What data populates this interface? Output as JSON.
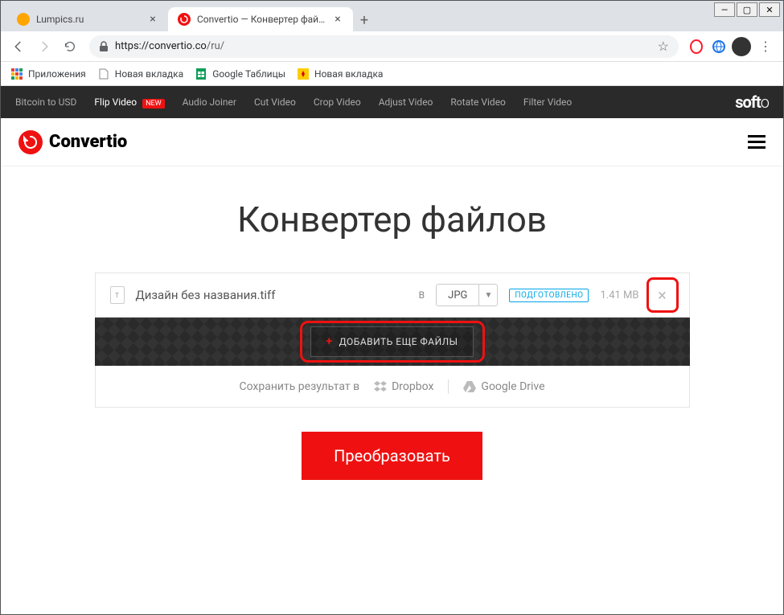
{
  "window": {
    "tabs": [
      {
        "title": "Lumpics.ru",
        "active": false
      },
      {
        "title": "Convertio — Конвертер файлов",
        "active": true
      }
    ]
  },
  "toolbar": {
    "url_scheme": "https://",
    "url_host": "convertio.co",
    "url_path": "/ru/"
  },
  "bookmarks": [
    {
      "label": "Приложения"
    },
    {
      "label": "Новая вкладка"
    },
    {
      "label": "Google Таблицы"
    },
    {
      "label": "Новая вкладка"
    }
  ],
  "promo": {
    "items": [
      "Bitcoin to USD",
      "Flip Video",
      "Audio Joiner",
      "Cut Video",
      "Crop Video",
      "Adjust Video",
      "Rotate Video",
      "Filter Video"
    ],
    "new_badge": "NEW",
    "brand": "softo"
  },
  "header": {
    "logo": "Convertio"
  },
  "main": {
    "title": "Конвертер файлов",
    "file": {
      "name": "Дизайн без названия.tiff",
      "to_label": "В",
      "format": "JPG",
      "status": "ПОДГОТОВЛЕНО",
      "size": "1.41 MB"
    },
    "add_more_label": "ДОБАВИТЬ ЕЩЕ ФАЙЛЫ",
    "save_label": "Сохранить результат в",
    "save_options": [
      "Dropbox",
      "Google Drive"
    ],
    "convert_label": "Преобразовать"
  }
}
